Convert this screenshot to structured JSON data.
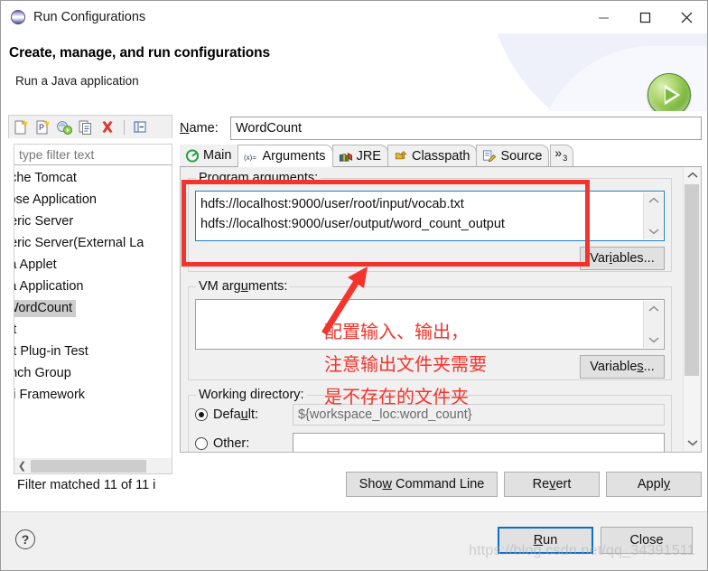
{
  "window": {
    "title": "Run Configurations",
    "icon": "eclipse-globe-icon",
    "minimize_label": "—",
    "maximize_label": "□",
    "close_label": "✕"
  },
  "header": {
    "title": "Create, manage, and run configurations",
    "subtitle": "Run a Java application",
    "badge_icon": "green-run-play-icon"
  },
  "left_panel": {
    "toolbar": [
      {
        "name": "new-configuration-icon",
        "tooltip": "New launch configuration"
      },
      {
        "name": "new-prototype-icon",
        "tooltip": "New prototype"
      },
      {
        "name": "new-launch-group-icon",
        "tooltip": "New launch group"
      },
      {
        "name": "duplicate-icon",
        "tooltip": "Duplicate"
      },
      {
        "name": "delete-icon",
        "tooltip": "Delete"
      },
      {
        "name": "collapse-all-icon",
        "tooltip": "Collapse All"
      }
    ],
    "filter": {
      "placeholder": "type filter text",
      "value": ""
    },
    "tree_items": [
      {
        "label": "ache Tomcat",
        "selected": false
      },
      {
        "label": "lipse Application",
        "selected": false
      },
      {
        "label": "neric Server",
        "selected": false
      },
      {
        "label": "neric Server(External La",
        "selected": false
      },
      {
        "label": "va Applet",
        "selected": false
      },
      {
        "label": "va Application",
        "selected": false
      },
      {
        "label": "WordCount",
        "selected": true
      },
      {
        "label": "nit",
        "selected": false
      },
      {
        "label": "nit Plug-in Test",
        "selected": false
      },
      {
        "label": "unch Group",
        "selected": false
      },
      {
        "label": "Gi Framework",
        "selected": false
      }
    ],
    "status": "Filter matched 11 of 11 i"
  },
  "right_panel": {
    "name_label": "Name:",
    "name_value": "WordCount",
    "tabs": [
      {
        "label": "Main",
        "icon": "java-main-class-icon",
        "active": false
      },
      {
        "label": "Arguments",
        "icon": "variable-xequals-icon",
        "active": true
      },
      {
        "label": "JRE",
        "icon": "jre-books-icon",
        "active": false
      },
      {
        "label": "Classpath",
        "icon": "classpath-folders-icon",
        "active": false
      },
      {
        "label": "Source",
        "icon": "source-lookup-icon",
        "active": false
      }
    ],
    "tab_overflow_label": "»",
    "tab_overflow_count": "3",
    "program_arguments": {
      "group_label": "Program arguments:",
      "value_lines": [
        "hdfs://localhost:9000/user/root/input/vocab.txt",
        "hdfs://localhost:9000/user/output/word_count_output"
      ],
      "variables_button": "Variables..."
    },
    "vm_arguments": {
      "group_label": "VM arguments:",
      "value": "",
      "variables_button": "Variables..."
    },
    "working_directory": {
      "group_label": "Working directory:",
      "default_label": "Default:",
      "default_value": "${workspace_loc:word_count}",
      "default_selected": true,
      "other_label": "Other:",
      "other_value": ""
    }
  },
  "buttons": {
    "show_command_line": "Show Command Line",
    "revert": "Revert",
    "apply": "Apply",
    "run": "Run",
    "close": "Close",
    "help_icon": "help-question-icon"
  },
  "annotations": {
    "highlight_color": "#f4342c",
    "lines": [
      "配置输入、输出，",
      "注意输出文件夹需要",
      "是不存在的文件夹"
    ],
    "watermark": "https://blog.csdn.net/qq_34391511"
  }
}
